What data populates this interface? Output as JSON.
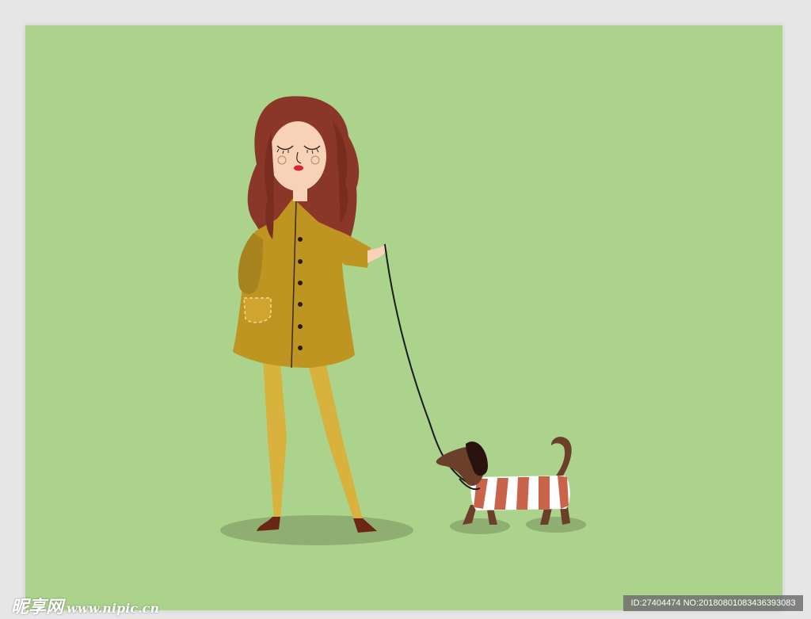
{
  "scene": {
    "subject": "girl-walking-dog",
    "colors": {
      "background": "#abd38b",
      "page": "#e6e6e6",
      "hair": "#8a3628",
      "skin": "#f7d2b8",
      "coat": "#bf9522",
      "tights": "#d8b23c",
      "shoe": "#6b2616",
      "dog": "#6b3f2a",
      "dog_ear": "#2a120e",
      "sweater_stripe": "#c9644a",
      "shadow": "#8fae72",
      "leash": "#1a1a1a"
    }
  },
  "watermark": {
    "logo_cn": "昵享网",
    "logo_url": "www.nipic.cn"
  },
  "id_stamp": {
    "text": "ID:27404474 NO:20180801083436393083"
  }
}
